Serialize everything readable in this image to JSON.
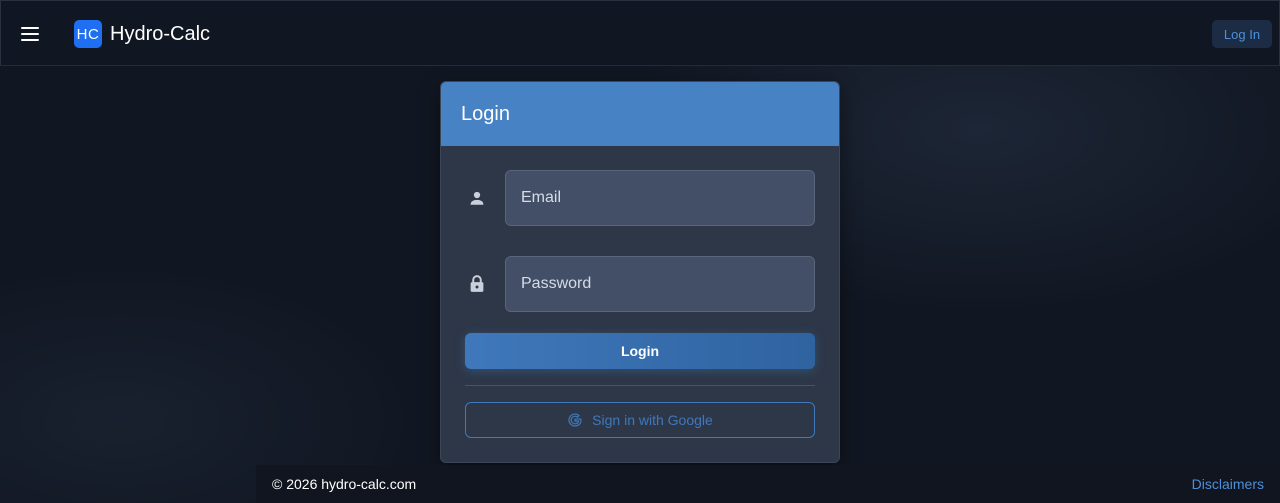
{
  "header": {
    "menu_icon": "hamburger-menu-icon",
    "logo_text": "HC",
    "app_name": "Hydro-Calc",
    "login_link": "Log In"
  },
  "login_card": {
    "title": "Login",
    "email": {
      "icon": "person-icon",
      "placeholder": "Email",
      "value": ""
    },
    "password": {
      "icon": "lock-icon",
      "placeholder": "Password",
      "value": ""
    },
    "submit_label": "Login",
    "google_label": "Sign in with Google",
    "google_icon": "google-g-icon"
  },
  "footer": {
    "copyright": "© 2026 hydro-calc.com",
    "disclaimers": "Disclaimers"
  },
  "colors": {
    "background": "#111722",
    "card": "#2d3748",
    "card_header": "#4682c4",
    "accent": "#3f78bb",
    "logo": "#1f6ff2"
  }
}
